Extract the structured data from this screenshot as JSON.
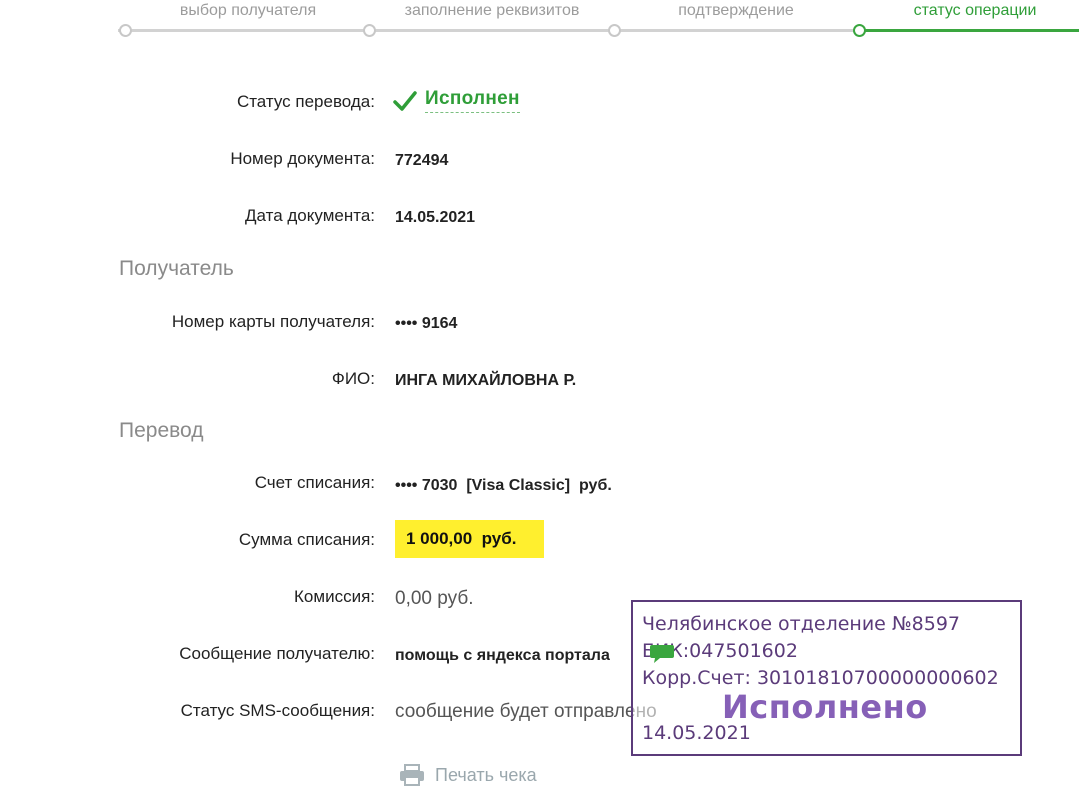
{
  "stepper": {
    "steps": [
      {
        "label": "выбор получателя"
      },
      {
        "label": "заполнение реквизитов"
      },
      {
        "label": "подтверждение"
      },
      {
        "label": "статус операции"
      }
    ]
  },
  "status": {
    "label": "Статус перевода:",
    "value": "Исполнен",
    "icon": "checkmark-icon",
    "color": "#2f9e38"
  },
  "document": {
    "number_label": "Номер документа:",
    "number": "772494",
    "date_label": "Дата документа:",
    "date": "14.05.2021"
  },
  "recipient": {
    "section_title": "Получатель",
    "card_label": "Номер карты получателя:",
    "card": "•••• 9164",
    "name_label": "ФИО:",
    "name": "ИНГА МИХАЙЛОВНА Р."
  },
  "transfer": {
    "section_title": "Перевод",
    "account_label": "Счет списания:",
    "account": "•••• 7030  [Visa Classic]  руб.",
    "amount_label": "Сумма списания:",
    "amount": "1 000,00  руб.",
    "amount_color": "#ffef2e",
    "fee_label": "Комиссия:",
    "fee": "0,00 руб.",
    "message_label": "Сообщение получателю:",
    "message": "помощь с яндекса портала",
    "sms_label": "Статус SMS-сообщения:",
    "sms": "сообщение будет отправлено"
  },
  "stamp": {
    "line1": "Челябинское отделение №8597",
    "line2": "БИК:047501602",
    "line3": "Корр.Счет: 30101810700000000602",
    "big": "Исполнено",
    "date": "14.05.2021",
    "color": "#5b3b7a"
  },
  "print": {
    "label": "Печать чека",
    "icon": "printer-icon"
  }
}
